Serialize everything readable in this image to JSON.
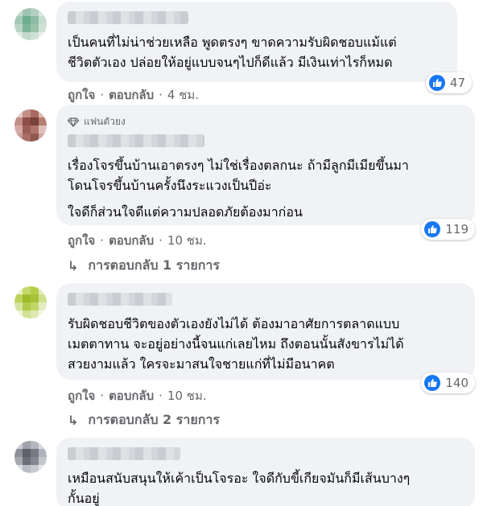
{
  "colors": {
    "like_blue": "#1877f2",
    "bubble_bg": "#f0f2f5",
    "meta_text": "#65676b"
  },
  "comments": [
    {
      "paragraphs": [
        "เป็นคนที่ไม่น่าช่วยเหลือ พูดตรงๆ ขาดความรับผิดชอบแม้แต่\nชีวิตตัวเอง ปล่อยให้อยู่แบบจนๆไปก็ดีแล้ว มีเงินเท่าไรก็หมด"
      ],
      "like_label": "ถูกใจ",
      "reply_label": "ตอบกลับ",
      "time": "4 ชม.",
      "reaction_icon": "like-icon",
      "reaction_count": "47"
    },
    {
      "badge_icon": "diamond-icon",
      "badge": "แฟนตัวยง",
      "paragraphs": [
        "เรื่องโจรขึ้นบ้านเอาตรงๆ ไม่ใช่เรื่องตลกนะ ถ้ามีลูกมีเมียขึ้นมา\nโดนโจรขึ้นบ้านครั้งนึงระแวงเป็นปีอ่ะ",
        "ใจดีก็ส่วนใจดีแต่ความปลอดภัยต้องมาก่อน"
      ],
      "like_label": "ถูกใจ",
      "reply_label": "ตอบกลับ",
      "time": "10 ชม.",
      "reaction_icon": "like-icon",
      "reaction_count": "119",
      "replies_icon": "reply-arrow-icon",
      "replies_label": "การตอบกลับ 1 รายการ"
    },
    {
      "paragraphs": [
        "รับผิดชอบชีวิตของตัวเองยังไม่ได้ ต้องมาอาศัยการตลาดแบบ\nเมตตาทาน จะอยู่อย่างนี้จนแก่เลยไหม ถึงตอนนั้นสังขารไม่ได้\nสวยงามแล้ว ใครจะมาสนใจชายแก่ที่ไม่มีอนาคต"
      ],
      "like_label": "ถูกใจ",
      "reply_label": "ตอบกลับ",
      "time": "10 ชม.",
      "reaction_icon": "like-icon",
      "reaction_count": "140",
      "replies_icon": "reply-arrow-icon",
      "replies_label": "การตอบกลับ 2 รายการ"
    },
    {
      "paragraphs": [
        "เหมือนสนับสนุนให้เค้าเป็นโจรอะ ใจดีกับขี้เกียจมันก็มีเส้นบางๆ\nกั้นอยู่"
      ]
    }
  ],
  "separator": "·"
}
